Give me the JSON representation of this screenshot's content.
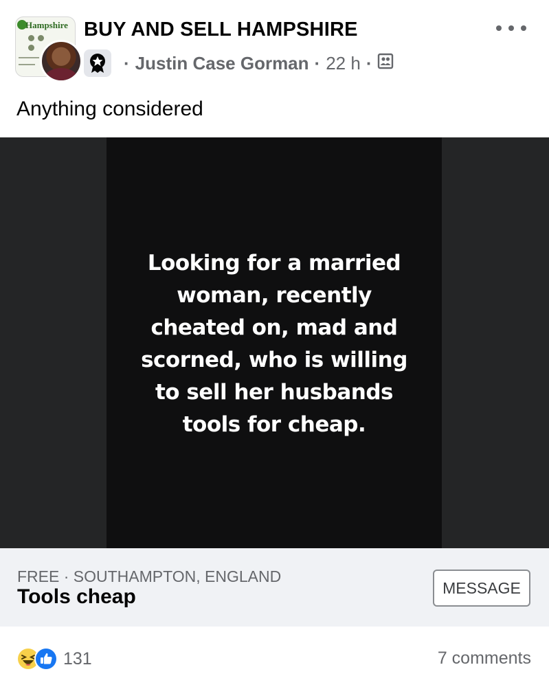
{
  "post": {
    "group_name": "BUY AND SELL HAMPSHIRE",
    "group_avatar_text": "Hampshire",
    "author": "Justin Case Gorman",
    "time": "22 h",
    "separator": "·",
    "caption": "Anything considered"
  },
  "media": {
    "lines": [
      "Looking for a married",
      "woman, recently",
      "cheated on, mad and",
      "scorned, who is willing",
      "to sell her husbands",
      "tools for cheap."
    ]
  },
  "listing": {
    "meta": "FREE · SOUTHAMPTON, ENGLAND",
    "title": "Tools cheap",
    "message_label": "MESSAGE"
  },
  "footer": {
    "reaction_count": "131",
    "comments": "7 comments"
  },
  "icons": {
    "badge": "community-badge-icon",
    "audience": "group-audience-icon",
    "more": "more-options-icon",
    "reaction_haha": "haha-reaction-icon",
    "reaction_like": "like-reaction-icon"
  },
  "colors": {
    "meta_gray": "#65676b",
    "like_blue": "#1877f2",
    "haha_yellow": "#f7d04a",
    "listing_bg": "#f0f2f5"
  }
}
